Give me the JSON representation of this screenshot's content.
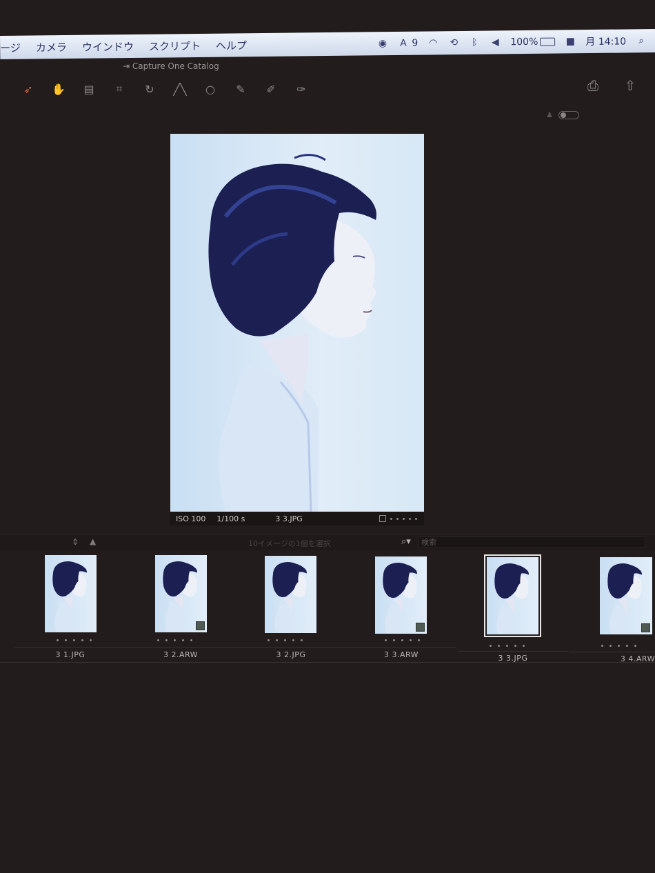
{
  "menubar": {
    "menus": [
      "ージ",
      "カメラ",
      "ウインドウ",
      "スクリプト",
      "ヘルプ"
    ],
    "status_adobe_count": "9",
    "battery_text": "100%",
    "clock": "月 14:10"
  },
  "window": {
    "title": "Capture One Catalog"
  },
  "toolbar": {
    "tools": [
      "cursor",
      "hand",
      "stamp",
      "crop",
      "rotate",
      "keystone",
      "circle",
      "brush",
      "eraser",
      "picker"
    ]
  },
  "viewer": {
    "iso": "ISO 100",
    "shutter": "1/100 s",
    "filename": "3 3.JPG"
  },
  "browser": {
    "selection_text": "10イメージの1個を選択",
    "search_placeholder": "検索"
  },
  "filmstrip": {
    "items": [
      {
        "name": "3 1.JPG"
      },
      {
        "name": "3 2.ARW"
      },
      {
        "name": "3 2.JPG"
      },
      {
        "name": "3 3.ARW"
      },
      {
        "name": "3 3.JPG"
      },
      {
        "name": "3 4.ARW"
      }
    ]
  },
  "colors": {
    "background": "#221c1c",
    "menubar": "#dde6f4",
    "accent_tool": "#c86a3c"
  }
}
